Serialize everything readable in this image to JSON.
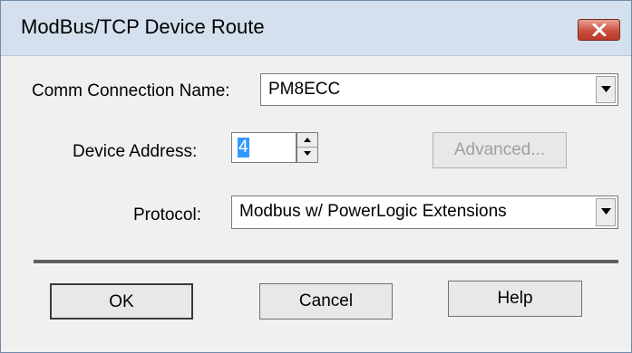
{
  "window": {
    "title": "ModBus/TCP Device Route"
  },
  "form": {
    "comm_label": "Comm Connection Name:",
    "comm_value": "PM8ECC",
    "address_label": "Device Address:",
    "address_value": "4",
    "protocol_label": "Protocol:",
    "protocol_value": "Modbus w/ PowerLogic Extensions"
  },
  "buttons": {
    "advanced": "Advanced...",
    "ok": "OK",
    "cancel": "Cancel",
    "help": "Help"
  },
  "icons": {
    "close": "close-icon",
    "dropdown": "chevron-down-icon",
    "spin_up": "triangle-up-icon",
    "spin_down": "triangle-down-icon"
  },
  "colors": {
    "close_button": "#c9503f",
    "selection": "#3399ff",
    "titlebar": "#d4e0ed"
  }
}
